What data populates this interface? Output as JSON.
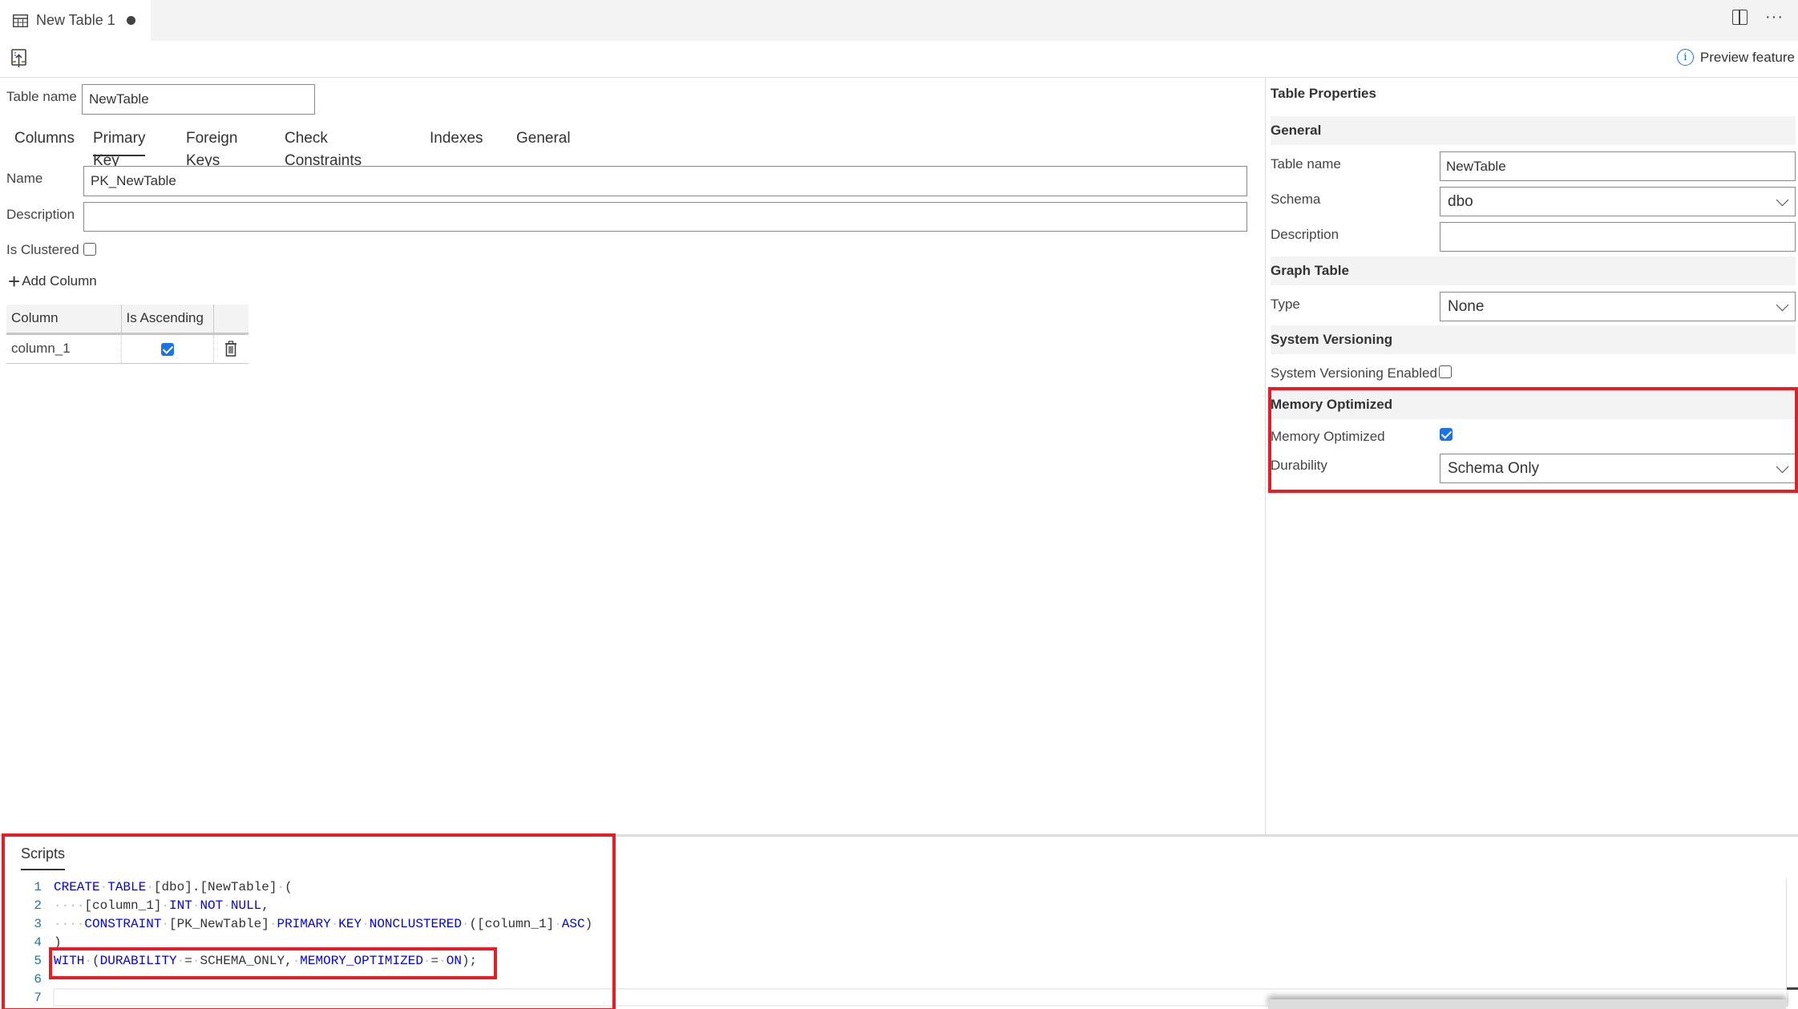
{
  "tab": {
    "title": "New Table 1",
    "dirty": true,
    "icon": "table-icon"
  },
  "tabbar_actions": {
    "split_icon": "split-editor-icon",
    "more_icon": "more-actions-icon",
    "more_glyph": "···"
  },
  "toolbar": {
    "publish_icon": "publish-icon",
    "preview_label": "Preview feature",
    "info_glyph": "i"
  },
  "designer": {
    "table_name_label": "Table name",
    "table_name_value": "NewTable",
    "tabs": [
      {
        "label": "Columns",
        "active": false
      },
      {
        "label": "Primary Key",
        "active": true
      },
      {
        "label": "Foreign Keys",
        "active": false
      },
      {
        "label": "Check Constraints",
        "active": false
      },
      {
        "label": "Indexes",
        "active": false
      },
      {
        "label": "General",
        "active": false
      }
    ],
    "primary_key": {
      "name_label": "Name",
      "name_value": "PK_NewTable",
      "description_label": "Description",
      "description_value": "",
      "is_clustered_label": "Is Clustered",
      "is_clustered": false,
      "add_column_label": "Add Column",
      "columns_header": [
        "Column",
        "Is Ascending",
        ""
      ],
      "columns": [
        {
          "column": "column_1",
          "is_ascending": true
        }
      ]
    }
  },
  "properties": {
    "title": "Table Properties",
    "general": {
      "header": "General",
      "table_name_label": "Table name",
      "table_name_value": "NewTable",
      "schema_label": "Schema",
      "schema_value": "dbo",
      "description_label": "Description",
      "description_value": ""
    },
    "graph_table": {
      "header": "Graph Table",
      "type_label": "Type",
      "type_value": "None"
    },
    "system_versioning": {
      "header": "System Versioning",
      "enabled_label": "System Versioning Enabled",
      "enabled": false
    },
    "memory_optimized": {
      "header": "Memory Optimized",
      "memory_optimized_label": "Memory Optimized",
      "memory_optimized": true,
      "durability_label": "Durability",
      "durability_value": "Schema Only"
    }
  },
  "scripts": {
    "title": "Scripts",
    "lines": [
      {
        "n": "1",
        "tokens": [
          [
            "kw",
            "CREATE"
          ],
          [
            "ws",
            "·"
          ],
          [
            "kw",
            "TABLE"
          ],
          [
            "ws",
            "·"
          ],
          [
            "tx",
            "[dbo].[NewTable]"
          ],
          [
            "ws",
            "·"
          ],
          [
            "tx",
            "("
          ]
        ]
      },
      {
        "n": "2",
        "tokens": [
          [
            "ws",
            "····"
          ],
          [
            "tx",
            "[column_1]"
          ],
          [
            "ws",
            "·"
          ],
          [
            "kw",
            "INT"
          ],
          [
            "ws",
            "·"
          ],
          [
            "kw",
            "NOT"
          ],
          [
            "ws",
            "·"
          ],
          [
            "kw",
            "NULL"
          ],
          [
            "tx",
            ","
          ]
        ]
      },
      {
        "n": "3",
        "tokens": [
          [
            "ws",
            "····"
          ],
          [
            "kw",
            "CONSTRAINT"
          ],
          [
            "ws",
            "·"
          ],
          [
            "tx",
            "[PK_NewTable]"
          ],
          [
            "ws",
            "·"
          ],
          [
            "kw",
            "PRIMARY"
          ],
          [
            "ws",
            "·"
          ],
          [
            "kw",
            "KEY"
          ],
          [
            "ws",
            "·"
          ],
          [
            "kw",
            "NONCLUSTERED"
          ],
          [
            "ws",
            "·"
          ],
          [
            "tx",
            "([column_1]"
          ],
          [
            "ws",
            "·"
          ],
          [
            "kw",
            "ASC"
          ],
          [
            "tx",
            ")"
          ]
        ]
      },
      {
        "n": "4",
        "tokens": [
          [
            "tx",
            ")"
          ]
        ]
      },
      {
        "n": "5",
        "tokens": [
          [
            "kw",
            "WITH"
          ],
          [
            "ws",
            "·"
          ],
          [
            "tx",
            "("
          ],
          [
            "kw",
            "DURABILITY"
          ],
          [
            "ws",
            "·"
          ],
          [
            "tx",
            "="
          ],
          [
            "ws",
            "·"
          ],
          [
            "tx",
            "SCHEMA_ONLY,"
          ],
          [
            "ws",
            "·"
          ],
          [
            "kw",
            "MEMORY_OPTIMIZED"
          ],
          [
            "ws",
            "·"
          ],
          [
            "tx",
            "="
          ],
          [
            "ws",
            "·"
          ],
          [
            "kw",
            "ON"
          ],
          [
            "tx",
            ");"
          ]
        ]
      },
      {
        "n": "6",
        "tokens": []
      },
      {
        "n": "7",
        "tokens": []
      }
    ]
  },
  "colors": {
    "accent": "#1a73e8",
    "highlight": "#e81c24",
    "keyword": "#0000ff",
    "line_number": "#237893"
  }
}
